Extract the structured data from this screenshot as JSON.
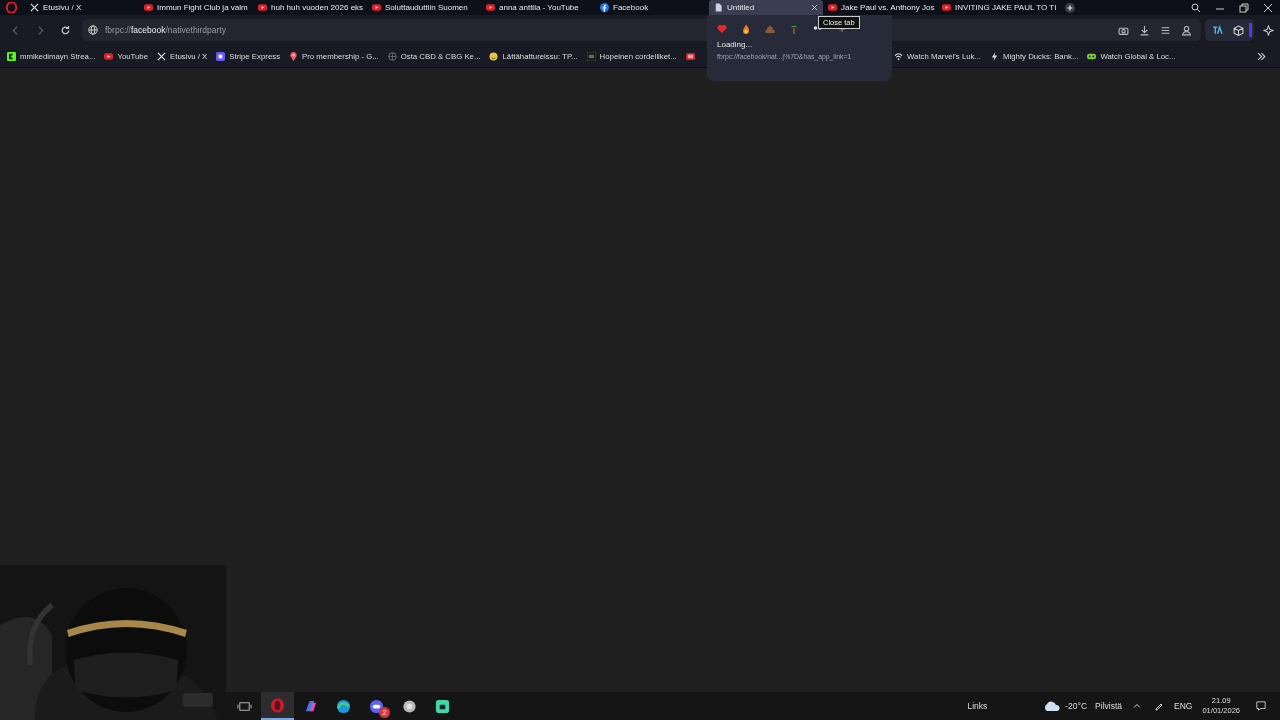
{
  "tabs": [
    {
      "title": "Etusivu / X",
      "kind": "x",
      "selected": false
    },
    {
      "title": "Immun Fight Club ja valm",
      "kind": "youtube",
      "selected": false
    },
    {
      "title": "huh huh vuoden 2026 eks",
      "kind": "youtube",
      "selected": false
    },
    {
      "title": "Soluttauduttiin Suomen",
      "kind": "youtube",
      "selected": false
    },
    {
      "title": "anna anttila - YouTube",
      "kind": "youtube",
      "selected": false
    },
    {
      "title": "Facebook",
      "kind": "facebook",
      "selected": false
    },
    {
      "title": "Untitled",
      "kind": "page",
      "selected": true
    },
    {
      "title": "Jake Paul vs. Anthony Jos",
      "kind": "youtube",
      "selected": false
    },
    {
      "title": "INVITING JAKE PAUL TO TI",
      "kind": "youtube",
      "selected": false
    }
  ],
  "close_tooltip": "Close tab",
  "tab_preview": {
    "status": "Loading...",
    "url": "fbrpc://facebook/nat...|%7D&has_app_link=1"
  },
  "address_bar": {
    "url": "fbrpc://**facebook**/nativethirdparty"
  },
  "bookmarks": [
    {
      "label": "mmikedimayn Strea...",
      "kind": "kick"
    },
    {
      "label": "YouTube",
      "kind": "youtube"
    },
    {
      "label": "Etusivu / X",
      "kind": "x"
    },
    {
      "label": "Stripe Express",
      "kind": "stripe"
    },
    {
      "label": "Pro membership - G...",
      "kind": "pin"
    },
    {
      "label": "Osta CBD & CBG Ke...",
      "kind": "globe"
    },
    {
      "label": "Lättähattureissu: TP...",
      "kind": "emoji"
    },
    {
      "label": "Hopeinen cordelliket...",
      "kind": "kt"
    },
    {
      "kind": "tv"
    },
    {
      "label": "Watch Marvel's Luk...",
      "kind": "wifi"
    },
    {
      "label": "Mighty Ducks: Bank...",
      "kind": "bolt"
    },
    {
      "label": "Watch Global & Loc...",
      "kind": "game"
    }
  ],
  "taskbar": {
    "apps": [
      {
        "kind": "taskview",
        "active": false
      },
      {
        "kind": "opera",
        "active": true
      },
      {
        "kind": "copilot",
        "active": false
      },
      {
        "kind": "edge",
        "active": false
      },
      {
        "kind": "discord",
        "active": false,
        "badge": "2"
      },
      {
        "kind": "gray",
        "active": false
      },
      {
        "kind": "green",
        "active": false
      }
    ],
    "links": "Links",
    "temperature": "-20°C",
    "weather": "Pilvistä",
    "language": "ENG",
    "time": "21.09",
    "date": "01/01/2026"
  }
}
